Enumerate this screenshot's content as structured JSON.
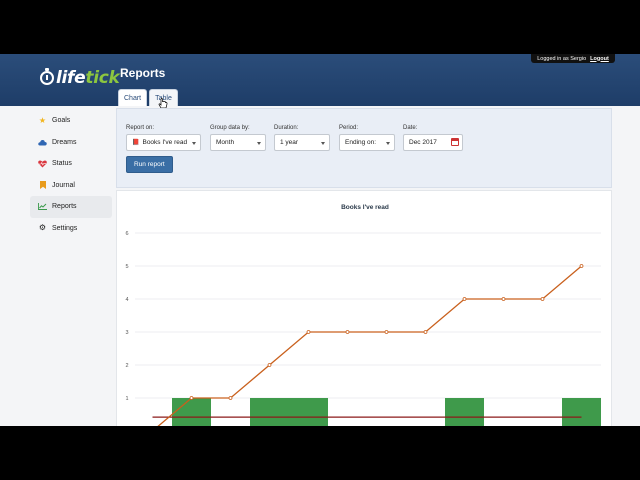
{
  "header": {
    "logo_text_1": "life",
    "logo_text_2": "tick",
    "page_title": "Reports",
    "user_label": "Logged in as Sergio",
    "logout_label": "Logout"
  },
  "tabs": [
    {
      "label": "Chart"
    },
    {
      "label": "Table"
    }
  ],
  "sidebar": {
    "items": [
      {
        "label": "Goals",
        "icon": "star-icon",
        "color": "#f2b51d"
      },
      {
        "label": "Dreams",
        "icon": "cloud-icon",
        "color": "#2f66b3"
      },
      {
        "label": "Status",
        "icon": "heart-pulse-icon",
        "color": "#d9363e"
      },
      {
        "label": "Journal",
        "icon": "bookmark-icon",
        "color": "#e89b1c"
      },
      {
        "label": "Reports",
        "icon": "chart-line-icon",
        "color": "#3a9a4b"
      },
      {
        "label": "Settings",
        "icon": "gear-icon",
        "color": "#222222"
      }
    ]
  },
  "filters": {
    "report_on": {
      "label": "Report on:",
      "value": "Books I've read"
    },
    "group_by": {
      "label": "Group data by:",
      "value": "Month"
    },
    "duration": {
      "label": "Duration:",
      "value": "1 year"
    },
    "period": {
      "label": "Period:",
      "value": "Ending on:"
    },
    "date": {
      "label": "Date:",
      "value": "Dec 2017"
    },
    "run_label": "Run report"
  },
  "chart_data": {
    "type": "bar",
    "title": "Books I've read",
    "ylim": [
      0,
      6
    ],
    "yticks": [
      1,
      2,
      3,
      4,
      5,
      6
    ],
    "grid": true,
    "bar_color": "#3f9a4b",
    "cumulative_color": "#c9601d",
    "average_color": "#8b1a1a",
    "series": [
      {
        "type": "bar",
        "values": [
          0,
          1,
          0,
          1,
          1,
          0,
          0,
          0,
          1,
          0,
          0,
          1
        ]
      },
      {
        "type": "line",
        "values": [
          0,
          1,
          1,
          2,
          3,
          3,
          3,
          3,
          4,
          4,
          4,
          5
        ]
      },
      {
        "type": "line",
        "values": [
          0.42,
          0.42,
          0.42,
          0.42,
          0.42,
          0.42,
          0.42,
          0.42,
          0.42,
          0.42,
          0.42,
          0.42
        ]
      }
    ]
  }
}
